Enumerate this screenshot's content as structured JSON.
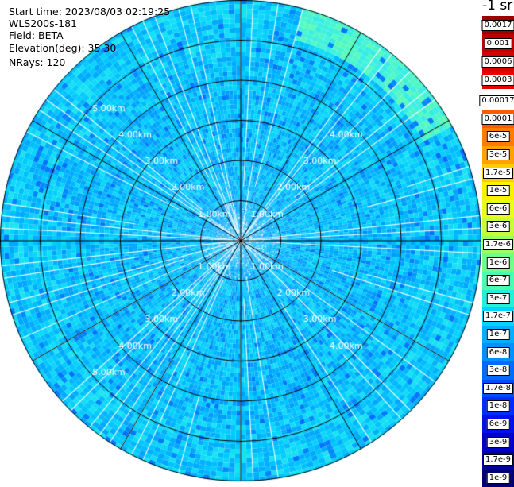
{
  "header": {
    "start_time": "Start time: 2023/08/03 02:19:25",
    "instrument": "WLS200s-181",
    "field": "Field: BETA",
    "elevation": "Elevation(deg): 35.30",
    "nrays": "NRays: 120"
  },
  "colorbar": {
    "unit_label": "-1 sr",
    "top_group": [
      {
        "label": "0.0017",
        "color": "#9b0000"
      },
      {
        "label": "0.001",
        "color": "#c00000"
      },
      {
        "label": "0.0006",
        "color": "#d50000"
      },
      {
        "label": "0.0003",
        "color": "#e60000"
      }
    ],
    "main_group": [
      {
        "label": "0.00017",
        "color": "#ffffff"
      },
      {
        "label": "0.0001",
        "color": "#ff5a00"
      },
      {
        "label": "6e-5",
        "color": "#ff7c00"
      },
      {
        "label": "3e-5",
        "color": "#ffa200"
      },
      {
        "label": "1.7e-5",
        "color": "#ffcc00"
      },
      {
        "label": "1e-5",
        "color": "#fff000"
      },
      {
        "label": "6e-6",
        "color": "#e8ff18"
      },
      {
        "label": "3e-6",
        "color": "#c4ff3a"
      },
      {
        "label": "1.7e-6",
        "color": "#9cff60"
      },
      {
        "label": "1e-6",
        "color": "#72ff88"
      },
      {
        "label": "6e-7",
        "color": "#48ffb0"
      },
      {
        "label": "3e-7",
        "color": "#22f0d8"
      },
      {
        "label": "1.7e-7",
        "color": "#00d4ff"
      },
      {
        "label": "1e-7",
        "color": "#00b0ff"
      },
      {
        "label": "6e-8",
        "color": "#0090ff"
      },
      {
        "label": "3e-8",
        "color": "#006cff"
      },
      {
        "label": "1.7e-8",
        "color": "#004cff"
      },
      {
        "label": "1e-8",
        "color": "#002cff"
      },
      {
        "label": "6e-9",
        "color": "#0010e8"
      },
      {
        "label": "3e-9",
        "color": "#0000c8"
      },
      {
        "label": "1.7e-9",
        "color": "#00009c"
      },
      {
        "label": "1e-9",
        "color": "#000070"
      }
    ]
  },
  "chart_data": {
    "type": "heatmap",
    "projection": "polar-ppi",
    "field": "BETA",
    "n_rays": 120,
    "range_rings_km": [
      1,
      2,
      3,
      4,
      5
    ],
    "max_range_km": 6.0,
    "spoke_count": 12,
    "ring_labels": [
      "1.00km",
      "2.00km",
      "3.00km",
      "4.00km",
      "5.00km"
    ],
    "dominant_value_range": [
      3e-08,
      3e-07
    ],
    "high_value_sector": {
      "azimuth_deg": [
        15,
        60
      ],
      "range_km": [
        5.5,
        6.0
      ],
      "value": 3e-06
    },
    "no_data_gaps": "thin white azimuth gaps between rays, denser inside 1 km"
  }
}
